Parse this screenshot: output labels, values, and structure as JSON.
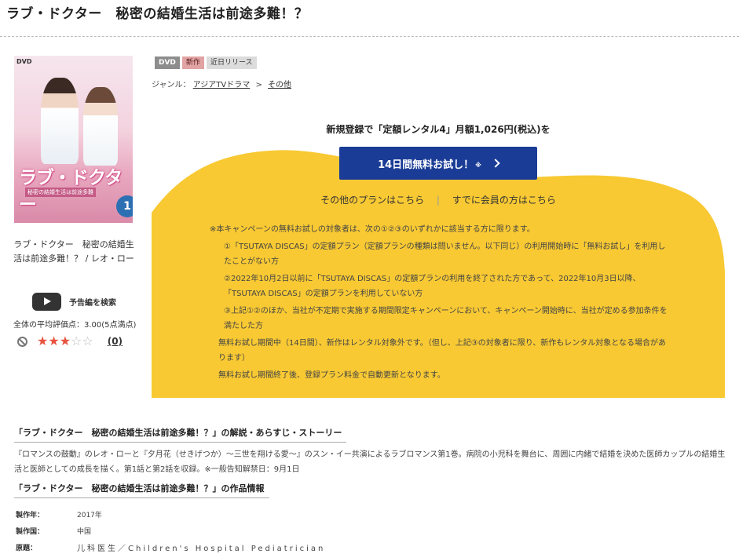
{
  "title": "ラブ・ドクター　秘密の結婚生活は前途多難！？",
  "cover": {
    "dvd_mark": "DVD",
    "logo_text": "ラブ・ドクター",
    "subtitle_text": "秘密の結婚生活は前途多難",
    "vol": "1"
  },
  "cover_caption": "ラブ・ドクター　秘密の結婚生活は前途多難！？ / レオ・ロー",
  "trailer_label": "予告編を検索",
  "avg_rating_text": "全体の平均評価点：3.00(5点満点)",
  "rating": {
    "value": 3,
    "max": 5,
    "review_count": "(0)"
  },
  "badges": [
    "DVD",
    "新作",
    "近日リリース"
  ],
  "genre": {
    "label": "ジャンル：",
    "items": [
      "アジアTVドラマ",
      "その他"
    ],
    "separator": ">"
  },
  "promo": {
    "headline": "新規登録で「定額レンタル4」月額1,026円(税込)を",
    "button_label": "14日間無料お試し！",
    "button_note": "※",
    "other_plans": "その他のプランはこちら",
    "divider": "|",
    "member_link": "すでに会員の方はこちら",
    "color": "#f8c933"
  },
  "notes": {
    "intro": "※本キャンペーンの無料お試しの対象者は、次の①②③のいずれかに該当する方に限ります。",
    "items": [
      "①「TSUTAYA DISCAS」の定額プラン（定額プランの種類は問いません。以下同じ）の利用開始時に「無料お試し」を利用したことがない方",
      "②2022年10月2日以前に「TSUTAYA DISCAS」の定額プランの利用を終了された方であって、2022年10月3日以降、「TSUTAYA DISCAS」の定額プランを利用していない方",
      "③上記①②のほか、当社が不定期で実施する期間限定キャンペーンにおいて、キャンペーン開始時に、当社が定める参加条件を満たした方"
    ],
    "extra": [
      "無料お試し期間中（14日間）、新作はレンタル対象外です。（但し、上記③の対象者に限り、新作もレンタル対象となる場合があります）",
      "無料お試し期間終了後、登録プラン料金で自動更新となります。"
    ]
  },
  "synopsis_section": {
    "title": "「ラブ・ドクター　秘密の結婚生活は前途多難！？」の解説・あらすじ・ストーリー",
    "text": "『ロマンスの鼓動』のレオ・ローと『夕月花（せきげつか）～三世を翔ける愛～』のスン・イー共演によるラブロマンス第1巻。病院の小児科を舞台に、周囲に内緒で結婚を決めた医師カップルの結婚生活と医師としての成長を描く。第1話と第2話を収録。※一般告知解禁日：9月1日"
  },
  "info_section": {
    "title": "「ラブ・ドクター　秘密の結婚生活は前途多難！？」の作品情報",
    "rows": [
      {
        "key": "製作年：",
        "value": "2017年"
      },
      {
        "key": "製作国：",
        "value": "中国"
      },
      {
        "key": "原題：",
        "value": "儿科医生／Children's Hospital Pediatrician"
      }
    ]
  }
}
